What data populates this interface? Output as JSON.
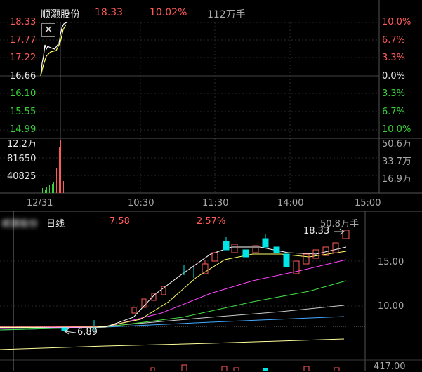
{
  "intraday": {
    "stock_name": "顺灏股份",
    "price": "18.33",
    "change_pct": "10.02%",
    "volume": "112万手",
    "price_axis_left": [
      "18.33",
      "17.77",
      "17.22",
      "16.66",
      "16.10",
      "15.55",
      "14.99"
    ],
    "pct_axis_right": [
      "10.0%",
      "6.7%",
      "3.3%",
      "0.0%",
      "3.3%",
      "6.7%",
      "10.0%"
    ],
    "volume_axis_left": [
      "12.2万",
      "81650",
      "40825"
    ],
    "volume_axis_right": [
      "50.6万",
      "33.7万",
      "16.9万"
    ],
    "time_axis": [
      "12/31",
      "10:30",
      "11:30",
      "14:00",
      "15:00"
    ],
    "close_icon": "close-icon"
  },
  "daily": {
    "name": "顺灏股份",
    "period_label": "日线",
    "ma_value": "7.58",
    "ma_change": "2.57%",
    "volume": "50.8万手",
    "high_marker": "18.33",
    "low_marker": "6.89",
    "price_axis_right": [
      "15.00",
      "10.00"
    ],
    "volume_axis_right": "417.00"
  },
  "colors": {
    "up": "#ff5a5a",
    "down": "#00e5e5",
    "ma5": "#ffffff",
    "ma10": "#ffff66",
    "ma20": "#ff44ff",
    "ma30": "#44dd44",
    "ma60": "#cccccc",
    "ma120": "#44aaff",
    "ma250": "#ffff99"
  }
}
